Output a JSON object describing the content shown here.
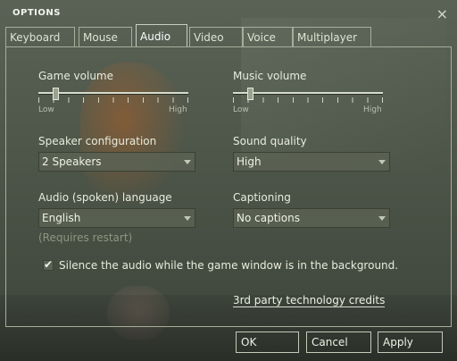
{
  "window": {
    "title": "OPTIONS",
    "close_glyph": "×"
  },
  "tabs": [
    {
      "label": "Keyboard"
    },
    {
      "label": "Mouse"
    },
    {
      "label": "Audio"
    },
    {
      "label": "Video"
    },
    {
      "label": "Voice"
    },
    {
      "label": "Multiplayer"
    }
  ],
  "active_tab": "Audio",
  "game_volume": {
    "label": "Game volume",
    "low": "Low",
    "high": "High",
    "level": 0.1
  },
  "music_volume": {
    "label": "Music volume",
    "low": "Low",
    "high": "High",
    "level": 0.1
  },
  "speaker_config": {
    "label": "Speaker configuration",
    "value": "2 Speakers"
  },
  "sound_quality": {
    "label": "Sound quality",
    "value": "High"
  },
  "language": {
    "label": "Audio (spoken) language",
    "value": "English",
    "note": "(Requires restart)"
  },
  "captioning": {
    "label": "Captioning",
    "value": "No captions"
  },
  "silence_background": {
    "label": "Silence the audio while the game window is in the background.",
    "checked": true,
    "check_glyph": "✔"
  },
  "credits_link": "3rd party technology credits",
  "buttons": {
    "ok": "OK",
    "cancel": "Cancel",
    "apply": "Apply"
  }
}
